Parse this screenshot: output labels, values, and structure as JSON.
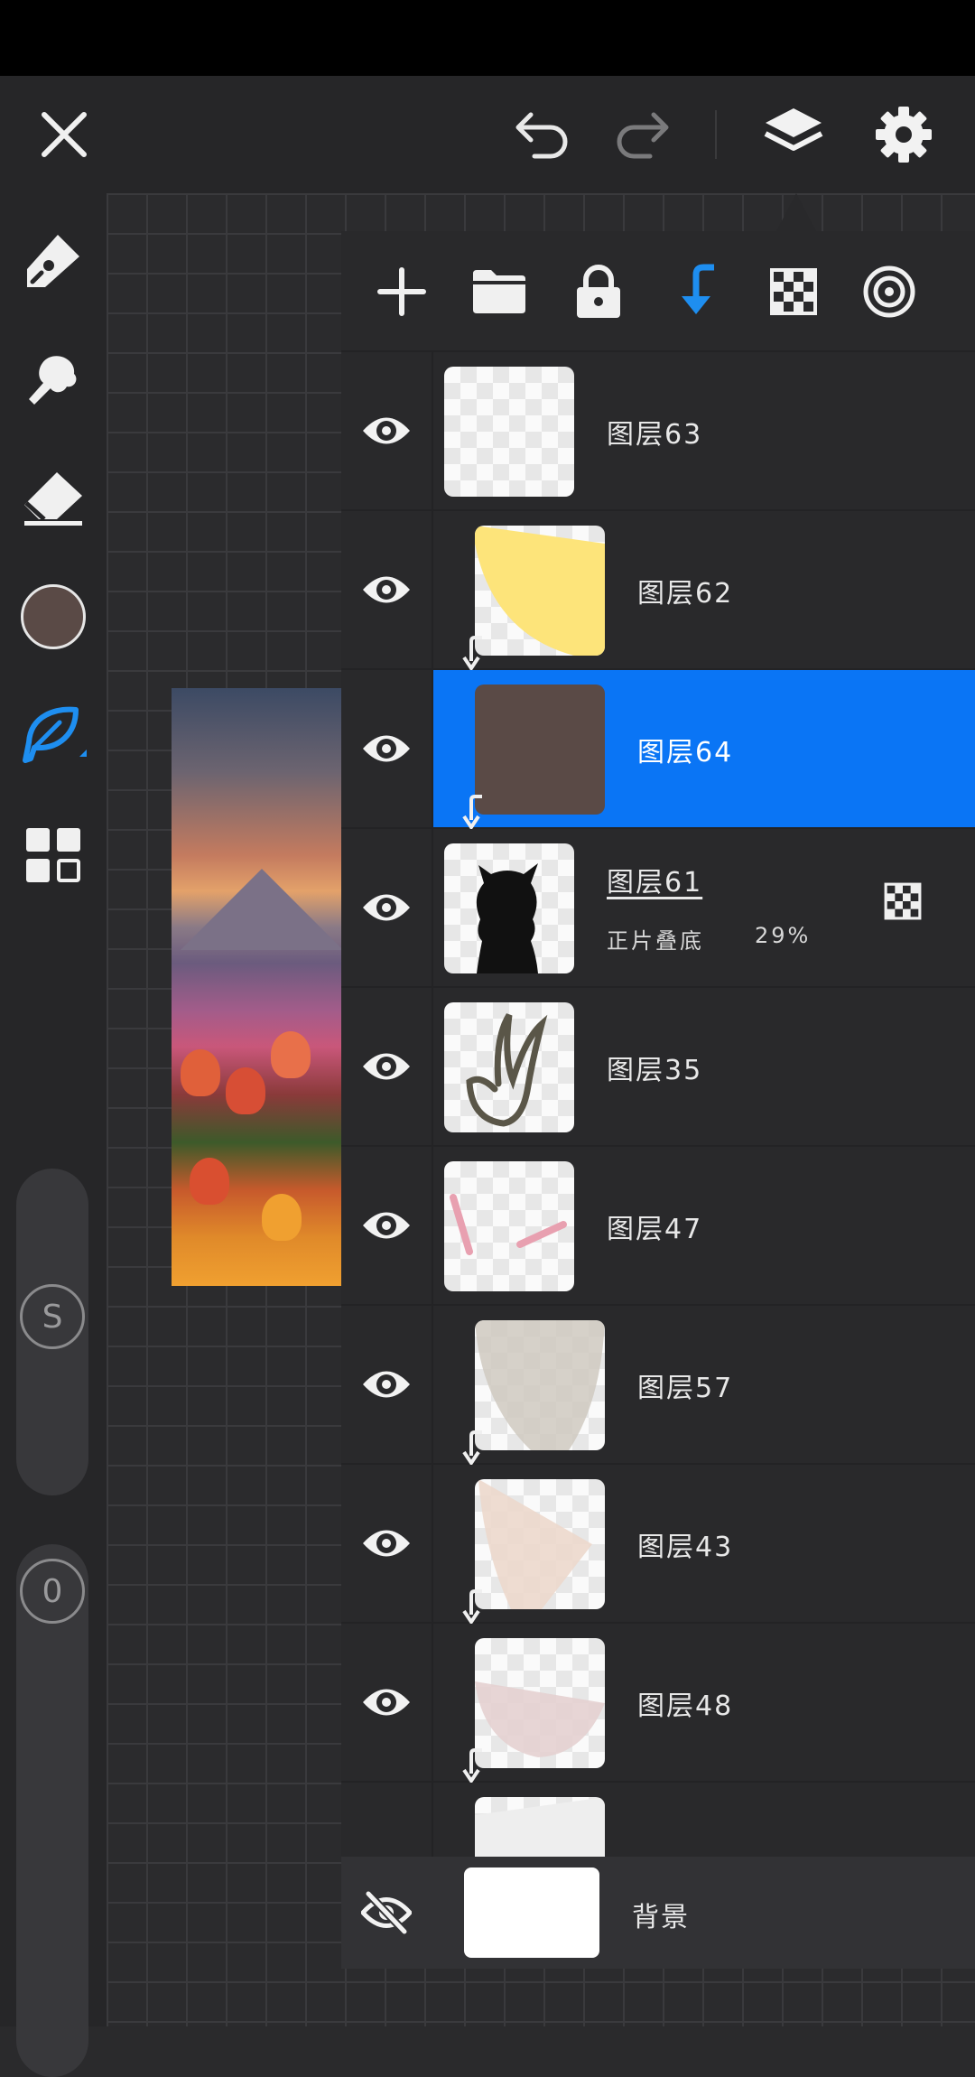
{
  "topbar": {
    "icons": [
      "close-icon",
      "undo-icon",
      "redo-icon",
      "layers-icon",
      "settings-icon"
    ]
  },
  "sidebar": {
    "tools": [
      "pencil-icon",
      "smudge-icon",
      "eraser-icon",
      "color-swatch",
      "leaf-brush-icon",
      "grid-icon"
    ],
    "current_color": "#5a4a46",
    "size_label": "S",
    "opacity_label": "0"
  },
  "layers_panel": {
    "toolbar_icons": [
      "add-icon",
      "folder-icon",
      "lock-icon",
      "clip-arrow-icon",
      "checker-icon",
      "target-icon"
    ],
    "accent": "#0a75f5",
    "layers": [
      {
        "name": "图层63",
        "clipped": false,
        "selected": false
      },
      {
        "name": "图层62",
        "clipped": true,
        "selected": false
      },
      {
        "name": "图层64",
        "clipped": true,
        "selected": true
      },
      {
        "name": "图层61",
        "clipped": false,
        "selected": false,
        "blend": "正片叠底",
        "opacity": "29%"
      },
      {
        "name": "图层35",
        "clipped": false,
        "selected": false
      },
      {
        "name": "图层47",
        "clipped": false,
        "selected": false
      },
      {
        "name": "图层57",
        "clipped": true,
        "selected": false
      },
      {
        "name": "图层43",
        "clipped": true,
        "selected": false
      },
      {
        "name": "图层48",
        "clipped": true,
        "selected": false
      }
    ],
    "background_label": "背景"
  }
}
